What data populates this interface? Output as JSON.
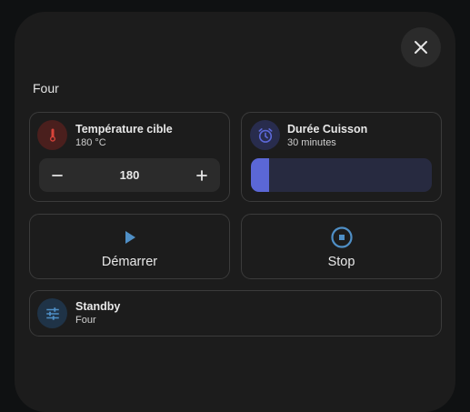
{
  "dialog": {
    "title": "Four"
  },
  "temperature": {
    "name": "Température cible",
    "state": "180 °C",
    "value": "180",
    "icon": "thermometer-icon",
    "color": "#d9443a"
  },
  "duree": {
    "name": "Durée Cuisson",
    "state": "30 minutes",
    "icon": "timer-icon",
    "color": "#5b67d6",
    "level": 0.1
  },
  "start": {
    "label": "Démarrer",
    "icon": "play-icon",
    "color": "#4f8fc6"
  },
  "stop": {
    "label": "Stop",
    "icon": "stop-circle-icon",
    "color": "#4f8fc6"
  },
  "standby": {
    "name": "Standby",
    "state": "Four",
    "icon": "tune-icon",
    "color": "#4f8fc6"
  }
}
